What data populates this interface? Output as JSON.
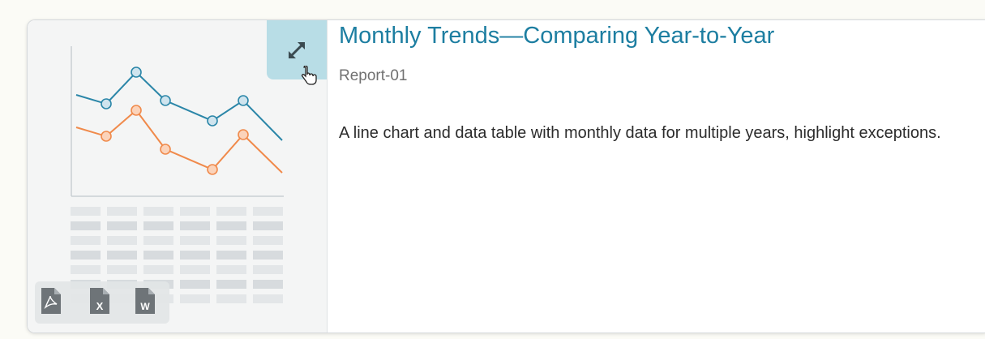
{
  "report": {
    "title": "Monthly Trends—Comparing Year-to-Year",
    "subtitle": "Report-01",
    "description": "A line chart and data table with monthly data for multiple years, highlight exceptions."
  },
  "thumbnail": {
    "series_colors": [
      "#2b86a8",
      "#f08a4b"
    ],
    "expand_icon": "expand-arrows-icon",
    "cursor_icon": "hand-pointer-icon"
  },
  "file_types": [
    {
      "name": "pdf",
      "glyph": "‡"
    },
    {
      "name": "excel",
      "glyph": "X"
    },
    {
      "name": "word",
      "glyph": "W"
    }
  ],
  "colors": {
    "accent": "#1d7ea1",
    "expand_button": "#b8dde6"
  }
}
